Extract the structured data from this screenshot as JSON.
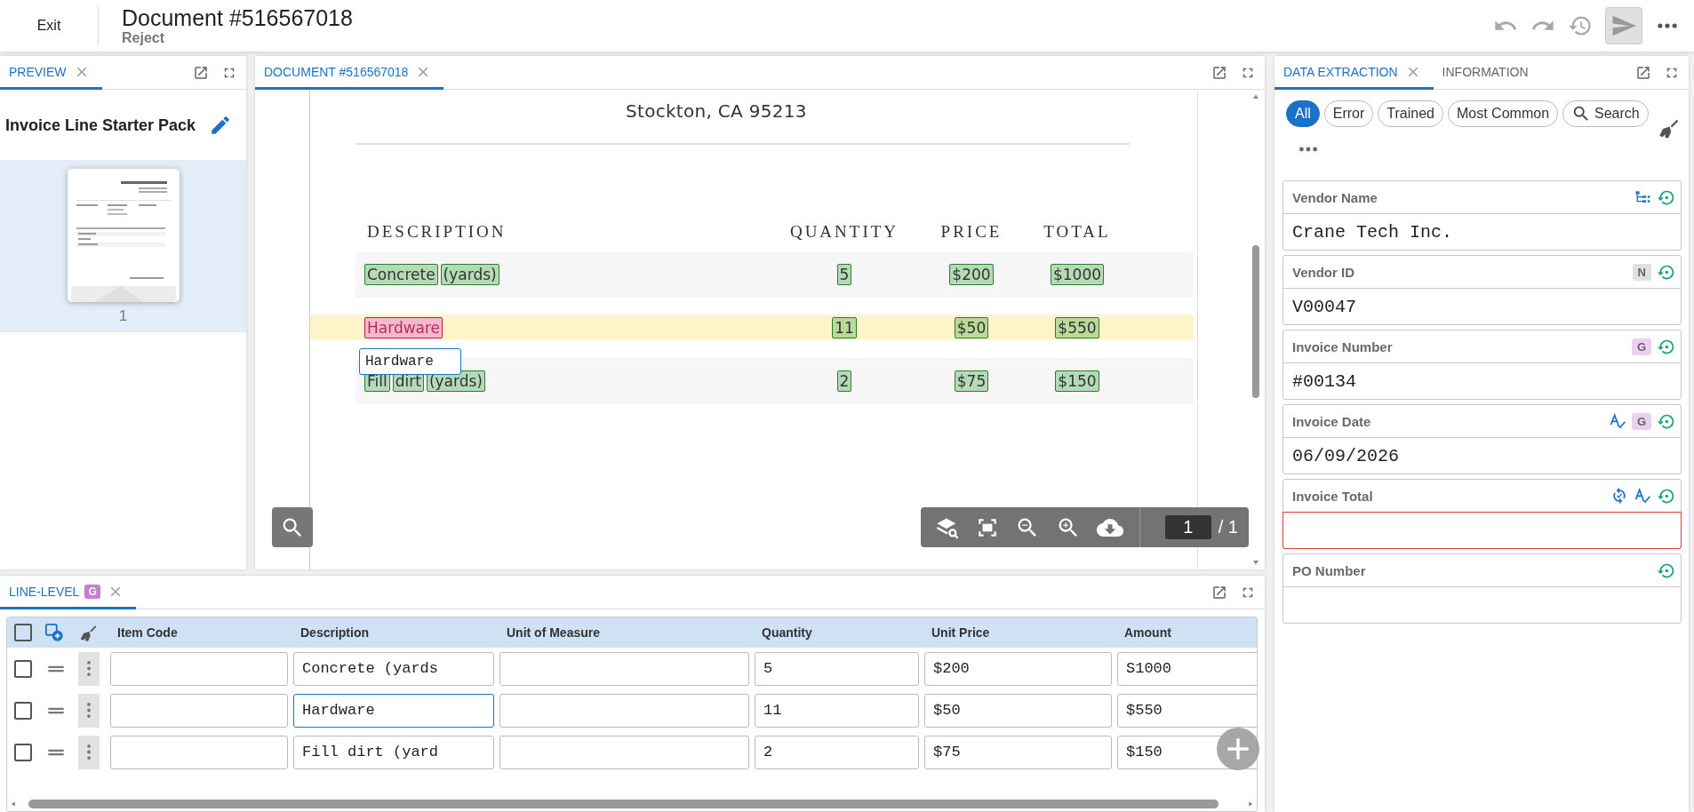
{
  "header": {
    "exit": "Exit",
    "title": "Document #516567018",
    "subtitle": "Reject",
    "actions": [
      {
        "kind": "undo",
        "disabled": true
      },
      {
        "kind": "redo",
        "disabled": true
      },
      {
        "kind": "history",
        "disabled": true
      },
      {
        "kind": "send",
        "disabled": true
      },
      {
        "kind": "more",
        "disabled": false
      }
    ]
  },
  "preview": {
    "tabs": [
      {
        "label": "PREVIEW",
        "selected": true,
        "closable": true
      }
    ],
    "title": "Invoice Line Starter Pack",
    "pages": [
      {
        "number": "1",
        "selected": true
      }
    ]
  },
  "document": {
    "tabs": [
      {
        "label": "DOCUMENT #516567018",
        "selected": true,
        "closable": true
      }
    ],
    "address": "Stockton, CA 95213",
    "columns": [
      "DESCRIPTION",
      "QUANTITY",
      "PRICE",
      "TOTAL"
    ],
    "rows": [
      {
        "highlighted": false,
        "cells": [
          {
            "words": [
              {
                "text": "Concrete",
                "selected": false
              },
              {
                "text": "(yards)",
                "selected": false
              }
            ]
          },
          {
            "words": [
              {
                "text": "5",
                "selected": false
              }
            ]
          },
          {
            "words": [
              {
                "text": "$200",
                "selected": false
              }
            ]
          },
          {
            "words": [
              {
                "text": "$1000",
                "selected": false
              }
            ]
          }
        ]
      },
      {
        "highlighted": true,
        "tooltip": "Hardware",
        "cells": [
          {
            "words": [
              {
                "text": "Hardware",
                "selected": true
              }
            ]
          },
          {
            "words": [
              {
                "text": "11",
                "selected": false
              }
            ]
          },
          {
            "words": [
              {
                "text": "$50",
                "selected": false
              }
            ]
          },
          {
            "words": [
              {
                "text": "$550",
                "selected": false
              }
            ]
          }
        ]
      },
      {
        "highlighted": false,
        "cells": [
          {
            "words": [
              {
                "text": "Fill",
                "selected": false
              },
              {
                "text": "dirt",
                "selected": false
              },
              {
                "text": "(yards)",
                "selected": false
              }
            ]
          },
          {
            "words": [
              {
                "text": "2",
                "selected": false
              }
            ]
          },
          {
            "words": [
              {
                "text": "$75",
                "selected": false
              }
            ]
          },
          {
            "words": [
              {
                "text": "$150",
                "selected": false
              }
            ]
          }
        ]
      }
    ],
    "page": {
      "current": "1",
      "total": "/ 1"
    }
  },
  "extraction": {
    "tabs": [
      {
        "label": "DATA EXTRACTION",
        "selected": true,
        "closable": true
      },
      {
        "label": "INFORMATION",
        "selected": false,
        "closable": false
      }
    ],
    "filters": [
      {
        "kind": "chip",
        "label": "All",
        "selected": true
      },
      {
        "kind": "chip",
        "label": "Error",
        "selected": false
      },
      {
        "kind": "chip",
        "label": "Trained",
        "selected": false
      },
      {
        "kind": "chip",
        "label": "Most Common",
        "selected": false
      },
      {
        "kind": "search",
        "label": "Search",
        "selected": false
      }
    ],
    "fields": [
      {
        "label": "Vendor Name",
        "value": "Crane Tech Inc.",
        "error": false,
        "badges": [
          {
            "kind": "hierarchy"
          },
          {
            "kind": "reset"
          }
        ]
      },
      {
        "label": "Vendor ID",
        "value": "V00047",
        "error": false,
        "badges": [
          {
            "kind": "letter",
            "text": "N",
            "color": "#e0e0e0"
          },
          {
            "kind": "reset"
          }
        ]
      },
      {
        "label": "Invoice Number",
        "value": "#00134",
        "error": false,
        "badges": [
          {
            "kind": "letter",
            "text": "G",
            "color": "#ebd0f2"
          },
          {
            "kind": "reset"
          }
        ]
      },
      {
        "label": "Invoice Date",
        "value": "06/09/2026",
        "error": false,
        "badges": [
          {
            "kind": "spellcheck"
          },
          {
            "kind": "letter",
            "text": "G",
            "color": "#ebd0f2"
          },
          {
            "kind": "reset"
          }
        ]
      },
      {
        "label": "Invoice Total",
        "error": true,
        "badges": [
          {
            "kind": "sync"
          },
          {
            "kind": "spellcheck"
          },
          {
            "kind": "reset"
          }
        ]
      },
      {
        "label": "PO Number",
        "error": false,
        "badges": [
          {
            "kind": "reset"
          }
        ]
      }
    ]
  },
  "line_level": {
    "tabs": [
      {
        "label": "LINE-LEVEL",
        "badge": "G",
        "selected": true,
        "closable": true
      }
    ],
    "select_all": {
      "checked": false
    },
    "columns": [
      "Item Code",
      "Description",
      "Unit of Measure",
      "Quantity",
      "Unit Price",
      "Amount"
    ],
    "rows": [
      {
        "checked": false,
        "cells": [
          {
            "focused": false
          },
          {
            "value": "Concrete (yards",
            "focused": false
          },
          {
            "focused": false
          },
          {
            "value": "5",
            "focused": false
          },
          {
            "value": "$200",
            "focused": false
          },
          {
            "value": "S1000",
            "focused": false
          }
        ]
      },
      {
        "checked": false,
        "cells": [
          {
            "focused": false
          },
          {
            "value": "Hardware",
            "focused": true
          },
          {
            "focused": false
          },
          {
            "value": "11",
            "focused": false
          },
          {
            "value": "$50",
            "focused": false
          },
          {
            "value": "$550",
            "focused": false
          }
        ]
      },
      {
        "checked": false,
        "cells": [
          {
            "focused": false
          },
          {
            "value": "Fill dirt (yard",
            "focused": false
          },
          {
            "focused": false
          },
          {
            "value": "2",
            "focused": false
          },
          {
            "value": "$75",
            "focused": false
          },
          {
            "value": "$150",
            "focused": false
          }
        ]
      }
    ]
  }
}
